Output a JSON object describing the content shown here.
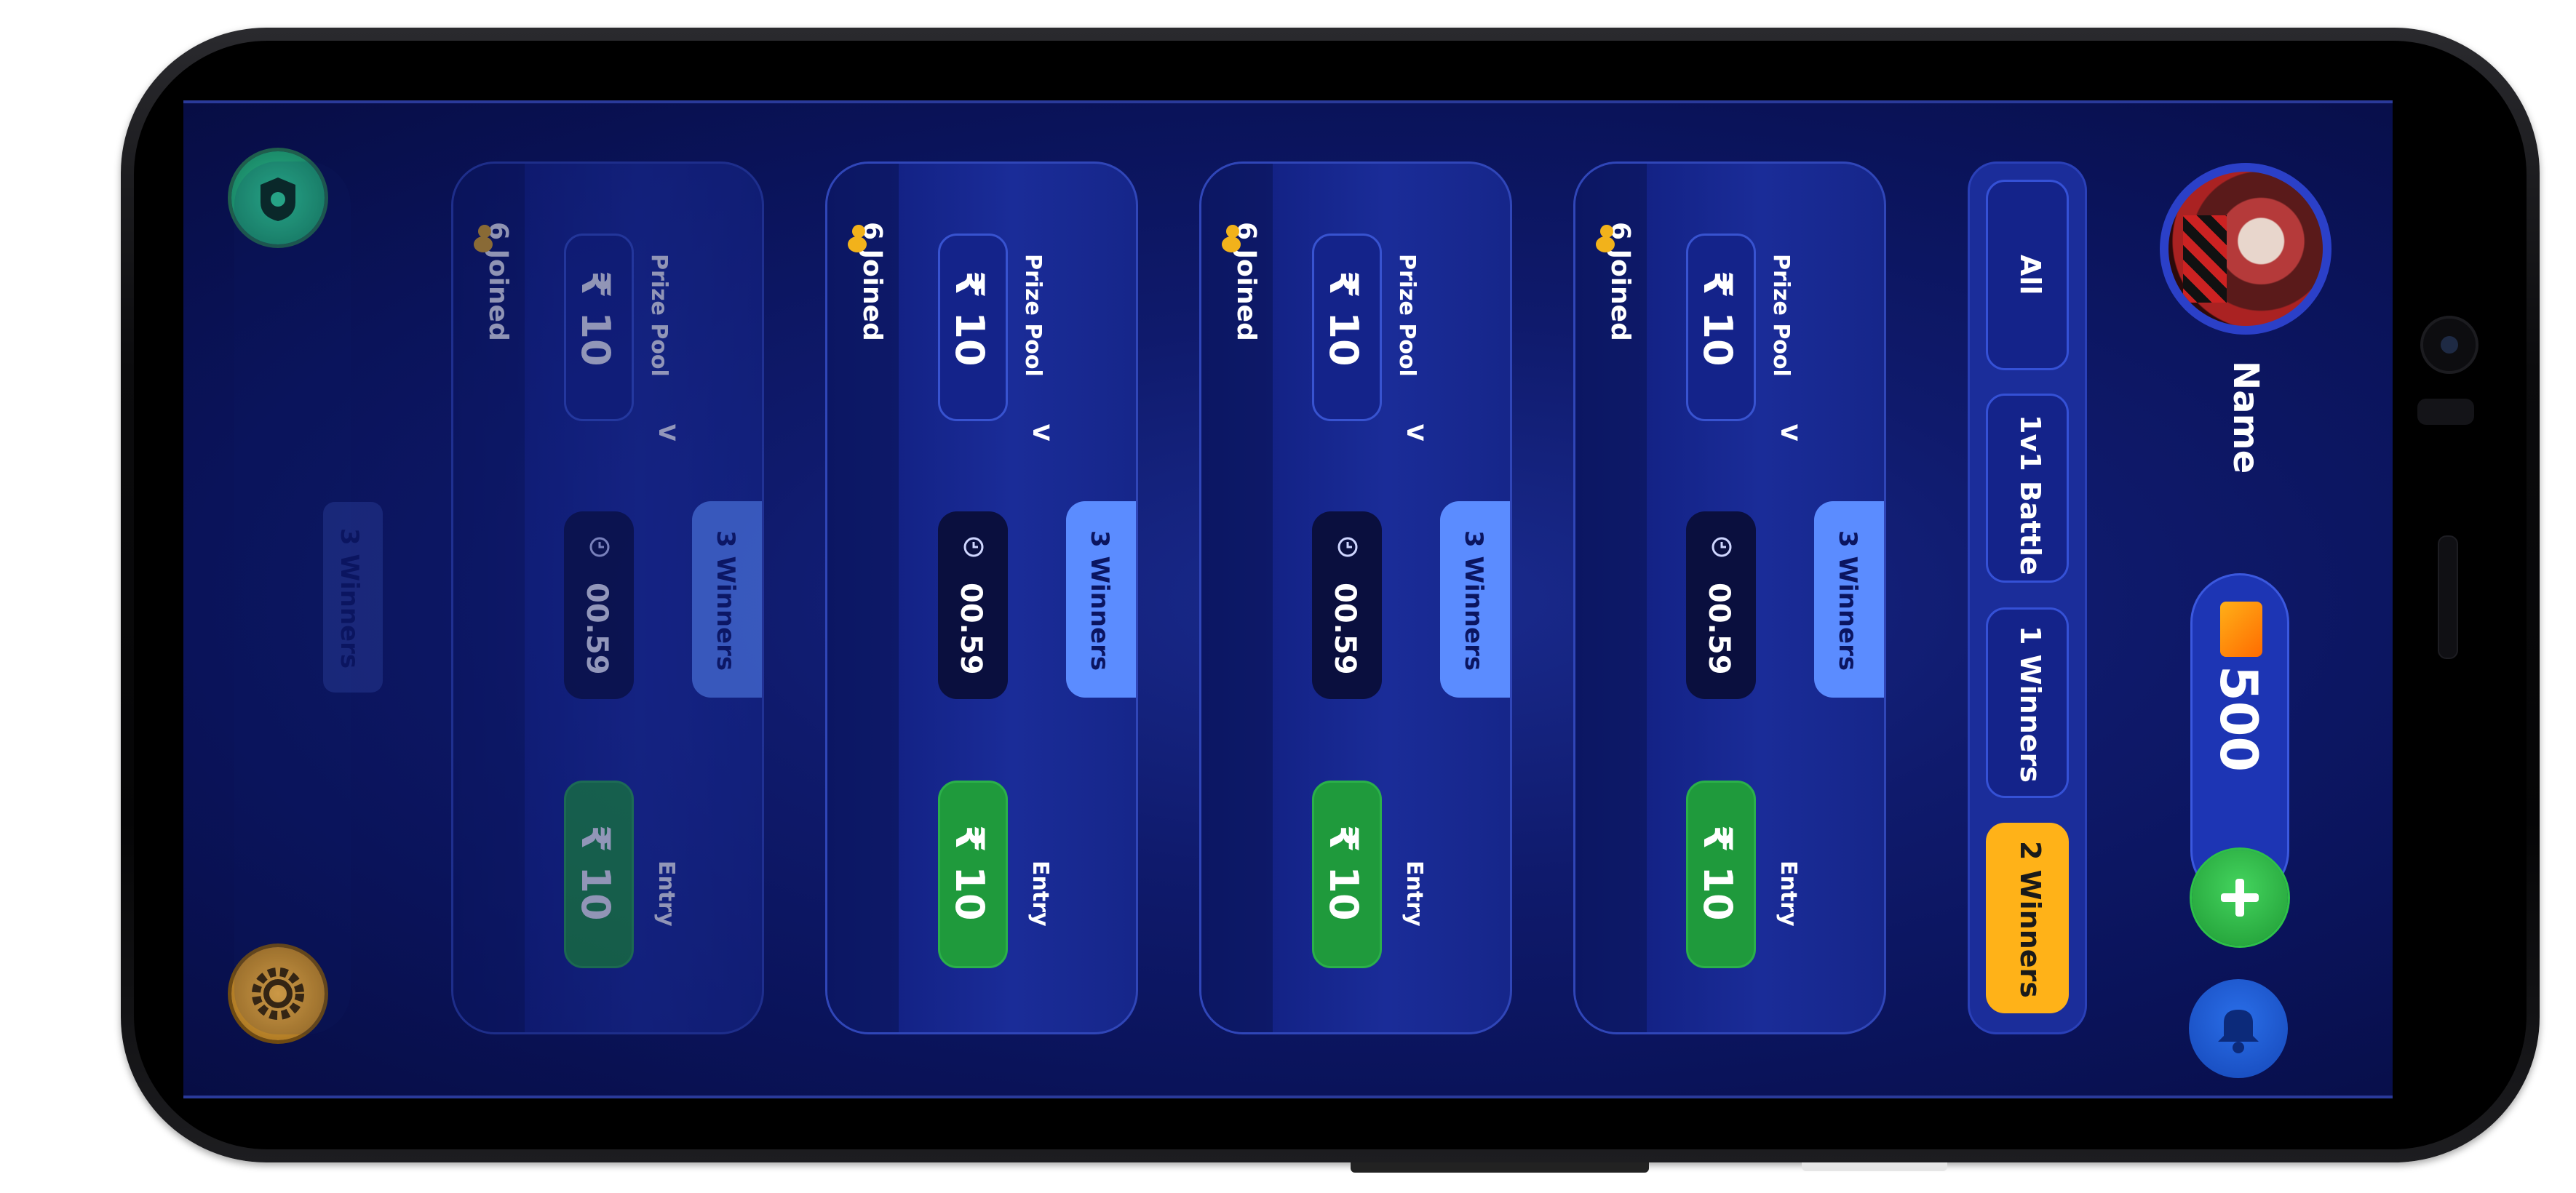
{
  "app": {
    "user_name": "Name",
    "coin_balance": "500"
  },
  "filters": [
    {
      "label": "All",
      "active": false
    },
    {
      "label": "1v1 Battle",
      "active": false
    },
    {
      "label": "1 Winners",
      "active": false
    },
    {
      "label": "2 Winners",
      "active": true
    }
  ],
  "cards": [
    {
      "prize_label": "Prize Pool",
      "prize_value": "₹ 10",
      "winners": "3 Winners",
      "timer": "00.59",
      "entry_label": "Entry",
      "entry_value": "₹ 10",
      "joined": "6 Joined"
    },
    {
      "prize_label": "Prize Pool",
      "prize_value": "₹ 10",
      "winners": "3 Winners",
      "timer": "00.59",
      "entry_label": "Entry",
      "entry_value": "₹ 10",
      "joined": "6 Joined"
    },
    {
      "prize_label": "Prize Pool",
      "prize_value": "₹ 10",
      "winners": "3 Winners",
      "timer": "00.59",
      "entry_label": "Entry",
      "entry_value": "₹ 10",
      "joined": "6 Joined"
    },
    {
      "prize_label": "Prize Pool",
      "prize_value": "₹ 10",
      "winners": "3 Winners",
      "timer": "00.59",
      "entry_label": "Entry",
      "entry_value": "₹ 10",
      "joined": "6 Joined"
    }
  ],
  "ghost_card": {
    "winners": "3 Winners"
  },
  "icons": {
    "chevron": "chevron-down-icon",
    "timer": "alarm-clock-icon",
    "people": "people-icon",
    "coin": "coin-icon",
    "add": "plus-icon",
    "bell": "bell-icon",
    "shield": "shield-icon",
    "settings": "gear-icon"
  },
  "colors": {
    "background": "#0f1a6c",
    "accent_active_tab": "#ffb218",
    "winners_badge": "#5b8cff",
    "entry_button": "#1f9a3c"
  }
}
